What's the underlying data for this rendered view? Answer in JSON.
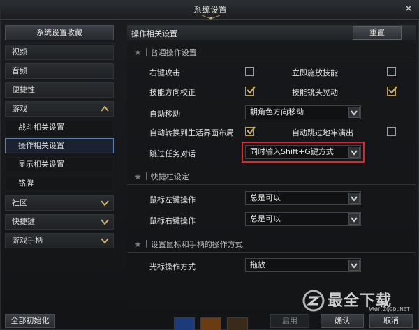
{
  "window": {
    "title": "系统设置",
    "close": "✕"
  },
  "sidebar": {
    "header": "系统设置收藏",
    "items": [
      {
        "label": "视频",
        "kind": "top"
      },
      {
        "label": "音频",
        "kind": "top"
      },
      {
        "label": "便捷性",
        "kind": "top"
      },
      {
        "label": "游戏",
        "kind": "top",
        "expanded": true
      },
      {
        "label": "战斗相关设置",
        "kind": "sub"
      },
      {
        "label": "操作相关设置",
        "kind": "sub",
        "active": true
      },
      {
        "label": "显示相关设置",
        "kind": "sub"
      },
      {
        "label": "铭牌",
        "kind": "sub"
      },
      {
        "label": "社区",
        "kind": "top",
        "collapsed": true
      },
      {
        "label": "快捷键",
        "kind": "top",
        "collapsed": true
      },
      {
        "label": "游戏手柄",
        "kind": "top",
        "collapsed": true
      }
    ],
    "reset_all": "全部初始化"
  },
  "main": {
    "title": "操作相关设置",
    "reset_label": "重置",
    "sections": {
      "general": {
        "title": "普通操作设置",
        "right_click_attack": {
          "label": "右键攻击",
          "checked": false
        },
        "instant_cast": {
          "label": "立即施放技能",
          "checked": false
        },
        "skill_direction": {
          "label": "技能方向校正",
          "checked": true
        },
        "skill_camera_shake": {
          "label": "技能镜头晃动",
          "checked": true
        },
        "auto_move": {
          "label": "自动移动",
          "value": "朝角色方向移动"
        },
        "auto_switch_life": {
          "label": "自动转换到生活界面布局",
          "checked": true
        },
        "auto_skip_dungeon": {
          "label": "自动跳过地牢演出",
          "checked": false
        },
        "skip_dialog": {
          "label": "跳过任务对话",
          "value": "同时输入Shift+G键方式"
        }
      },
      "quickbar": {
        "title": "快捷栏设定",
        "left_click": {
          "label": "鼠标左键操作",
          "value": "总是可以"
        },
        "right_click": {
          "label": "鼠标右键操作",
          "value": "总是可以"
        }
      },
      "mouse_pad": {
        "title": "设置鼠标和手柄的操作方式",
        "cursor_mode": {
          "label": "光标操作方式",
          "value": "拖放"
        }
      }
    }
  },
  "footer": {
    "apply": "启用",
    "confirm": "确认",
    "cancel": "取消"
  },
  "watermark": {
    "text": "最全下载",
    "url": "WWW.ZQGD.NET"
  },
  "colors": {
    "highlight": "#e0262b",
    "check": "#c9b06a",
    "active_border": "#5d7fb0"
  }
}
